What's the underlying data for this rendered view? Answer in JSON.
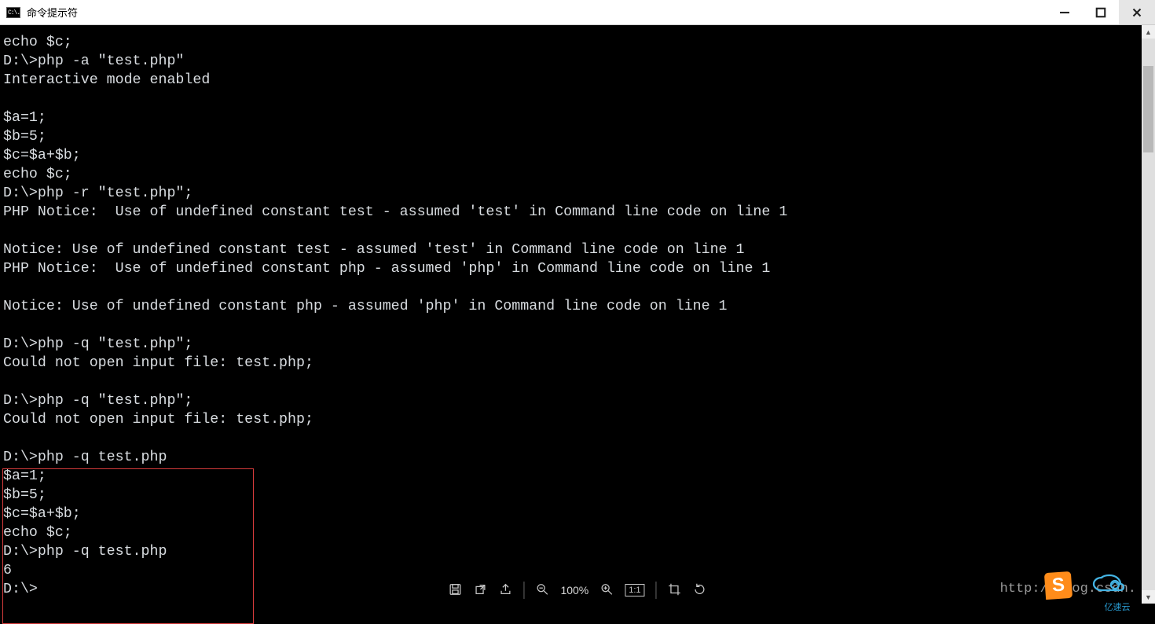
{
  "window": {
    "title": "命令提示符",
    "app_icon_text": "C:\\."
  },
  "terminal": {
    "lines": [
      "echo $c;",
      "D:\\>php -a \"test.php\"",
      "Interactive mode enabled",
      "",
      "$a=1;",
      "$b=5;",
      "$c=$a+$b;",
      "echo $c;",
      "D:\\>php -r \"test.php\";",
      "PHP Notice:  Use of undefined constant test - assumed 'test' in Command line code on line 1",
      "",
      "Notice: Use of undefined constant test - assumed 'test' in Command line code on line 1",
      "PHP Notice:  Use of undefined constant php - assumed 'php' in Command line code on line 1",
      "",
      "Notice: Use of undefined constant php - assumed 'php' in Command line code on line 1",
      "",
      "D:\\>php -q \"test.php\";",
      "Could not open input file: test.php;",
      "",
      "D:\\>php -q \"test.php\";",
      "Could not open input file: test.php;",
      "",
      "D:\\>php -q test.php",
      "$a=1;",
      "$b=5;",
      "$c=$a+$b;",
      "echo $c;",
      "D:\\>php -q test.php",
      "6",
      "D:\\>"
    ]
  },
  "toolbar": {
    "zoom": "100%",
    "ratio": "1:1"
  },
  "watermark": "http://blog.csdn.",
  "stickers": {
    "s_logo_letter": "S",
    "cloud_label": "亿速云"
  }
}
